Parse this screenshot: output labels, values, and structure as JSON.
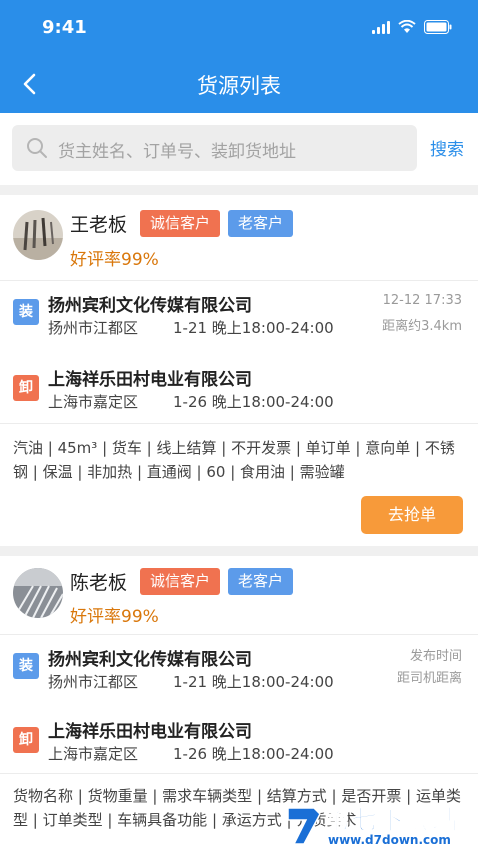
{
  "status_bar": {
    "time": "9:41"
  },
  "nav": {
    "title": "货源列表",
    "back_icon": "chevron-left-icon"
  },
  "search": {
    "placeholder": "货主姓名、订单号、装卸货地址",
    "button_label": "搜索"
  },
  "colors": {
    "primary": "#2a8ee9",
    "credit_tag": "#f07250",
    "old_tag": "#5c9bea",
    "rating": "#d9770b",
    "grab_button": "#f79a3a"
  },
  "cards": [
    {
      "owner": "王老板",
      "tags": [
        "诚信客户",
        "老客户"
      ],
      "rating": "好评率99%",
      "load": {
        "badge": "装",
        "company": "扬州宾利文化传媒有限公司",
        "address": "扬州市江都区",
        "time": "1-21 晚上18:00-24:00"
      },
      "unload": {
        "badge": "卸",
        "company": "上海祥乐田村电业有限公司",
        "address": "上海市嘉定区",
        "time": "1-26 晚上18:00-24:00"
      },
      "meta_top": "12-12 17:33",
      "meta_bottom": "距离约3.4km",
      "attrs": "汽油 | 45m³ | 货车 | 线上结算 | 不开发票 | 单订单 | 意向单 | 不锈钢 | 保温 | 非加热 | 直通阀 | 60 | 食用油 | 需验罐",
      "button_label": "去抢单"
    },
    {
      "owner": "陈老板",
      "tags": [
        "诚信客户",
        "老客户"
      ],
      "rating": "好评率99%",
      "load": {
        "badge": "装",
        "company": "扬州宾利文化传媒有限公司",
        "address": "扬州市江都区",
        "time": "1-21 晚上18:00-24:00"
      },
      "unload": {
        "badge": "卸",
        "company": "上海祥乐田村电业有限公司",
        "address": "上海市嘉定区",
        "time": "1-26 晚上18:00-24:00"
      },
      "meta_top": "发布时间",
      "meta_bottom": "距司机距离",
      "attrs": "货物名称 | 货物重量 | 需求车辆类型 | 结算方式 | 是否开票 | 运单类型 | 订单类型 | 车辆具备功能 | 承运方式 | 介质要求"
    }
  ],
  "watermark": {
    "title": "第七下载站",
    "url": "www.d7down.com"
  }
}
